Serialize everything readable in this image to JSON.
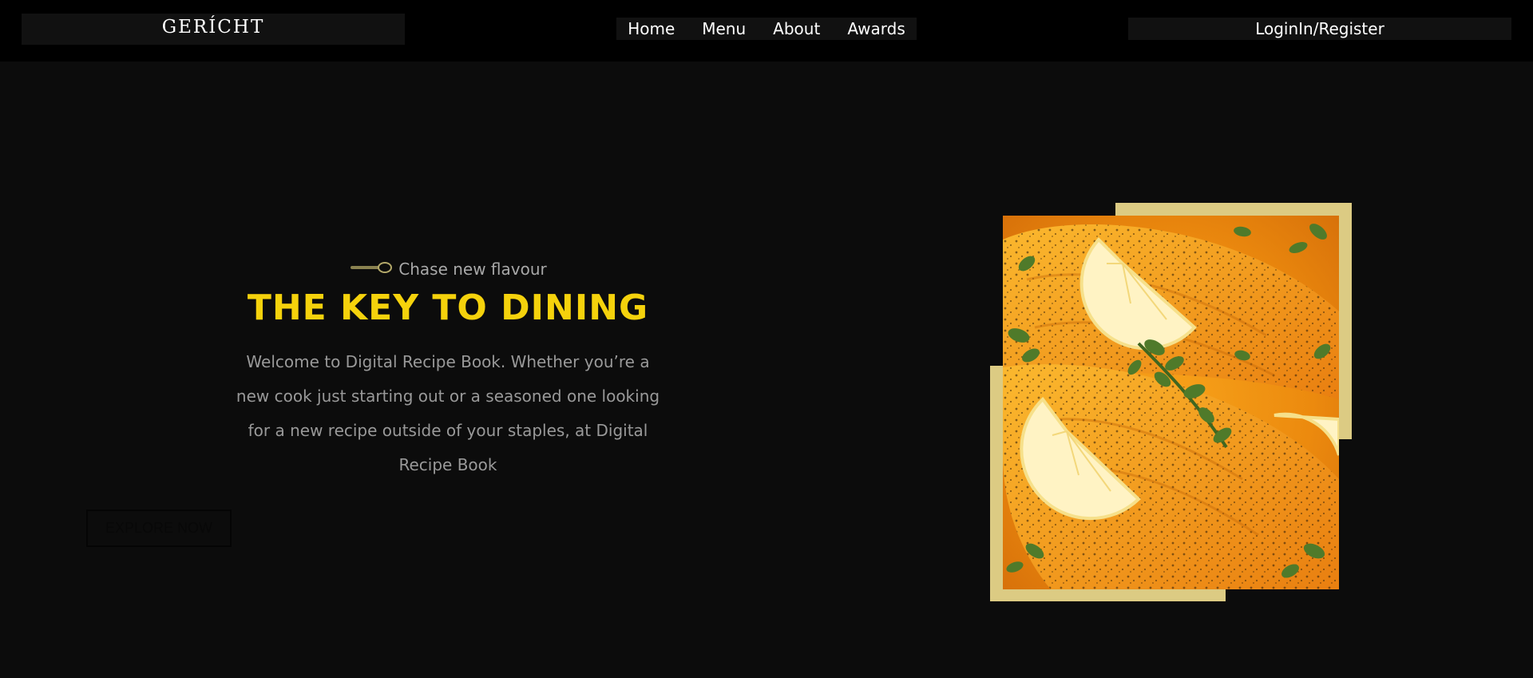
{
  "navbar": {
    "logo": "GERÍCHT",
    "links": [
      {
        "label": "Home"
      },
      {
        "label": "Menu"
      },
      {
        "label": "About"
      },
      {
        "label": "Awards"
      }
    ],
    "login_label": "LoginIn/Register"
  },
  "hero": {
    "subtitle": "Chase new flavour",
    "title": "THE KEY TO DINING",
    "description": "Welcome to Digital Recipe Book. Whether you’re a new cook just starting out or a seasoned one looking for a new recipe outside of your staples, at Digital Recipe Book",
    "cta_label": "EXPLORE NOW"
  },
  "image": {
    "subject": "salmon-with-lemon-and-herbs"
  },
  "colors": {
    "page_background": "#0c0c0c",
    "navbar_background": "#000000",
    "accent_yellow": "#f5d20c",
    "frame_gold": "#dccb83",
    "text_muted": "#999999"
  },
  "icons": {
    "subtitle_icon": "spoon-icon"
  }
}
